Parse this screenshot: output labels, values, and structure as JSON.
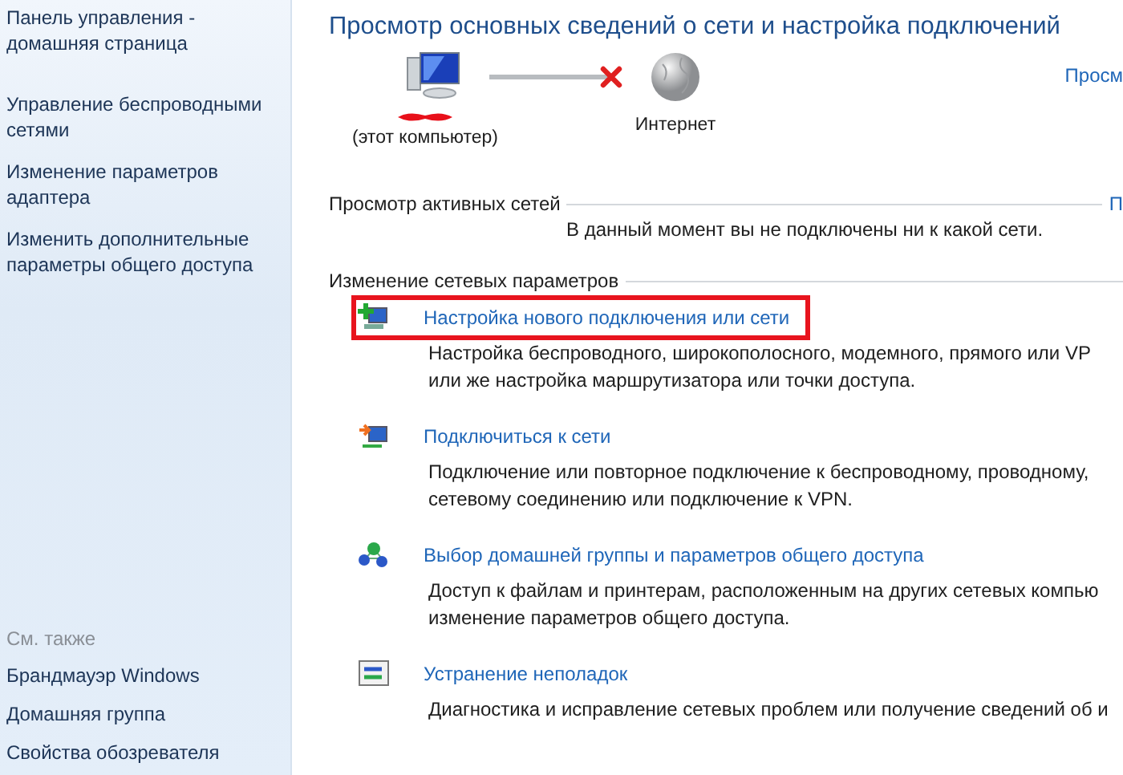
{
  "sidebar": {
    "home_link": "Панель управления - домашняя страница",
    "items": [
      {
        "label": "Управление беспроводными сетями"
      },
      {
        "label": "Изменение параметров адаптера"
      },
      {
        "label": "Изменить дополнительные параметры общего доступа"
      }
    ],
    "see_also": {
      "heading": "См. также",
      "links": [
        "Брандмауэр Windows",
        "Домашняя группа",
        "Свойства обозревателя"
      ]
    }
  },
  "main": {
    "title": "Просмотр основных сведений о сети и настройка подключений",
    "map": {
      "computer_label": "(этот компьютер)",
      "internet_label": "Интернет",
      "connected": false,
      "full_map_link": "Просм",
      "computer_name_redacted": true
    },
    "active_networks": {
      "heading": "Просмотр активных сетей",
      "side_link": "П",
      "message": "В данный момент вы не подключены ни к какой сети."
    },
    "change_settings": {
      "heading": "Изменение сетевых параметров",
      "tasks": [
        {
          "kind": "new-connection",
          "title": "Настройка нового подключения или сети",
          "highlighted": true,
          "description": [
            "Настройка беспроводного, широкополосного, модемного, прямого или VP",
            "или же настройка маршрутизатора или точки доступа."
          ]
        },
        {
          "kind": "connect",
          "title": "Подключиться к сети",
          "highlighted": false,
          "description": [
            "Подключение или повторное подключение к беспроводному, проводному,",
            "сетевому соединению или подключение к VPN."
          ]
        },
        {
          "kind": "homegroup",
          "title": "Выбор домашней группы и параметров общего доступа",
          "highlighted": false,
          "description": [
            "Доступ к файлам и принтерам, расположенным на других сетевых компью",
            "изменение параметров общего доступа."
          ]
        },
        {
          "kind": "troubleshoot",
          "title": "Устранение неполадок",
          "highlighted": false,
          "description": [
            "Диагностика и исправление сетевых проблем или получение сведений об и"
          ]
        }
      ]
    }
  }
}
